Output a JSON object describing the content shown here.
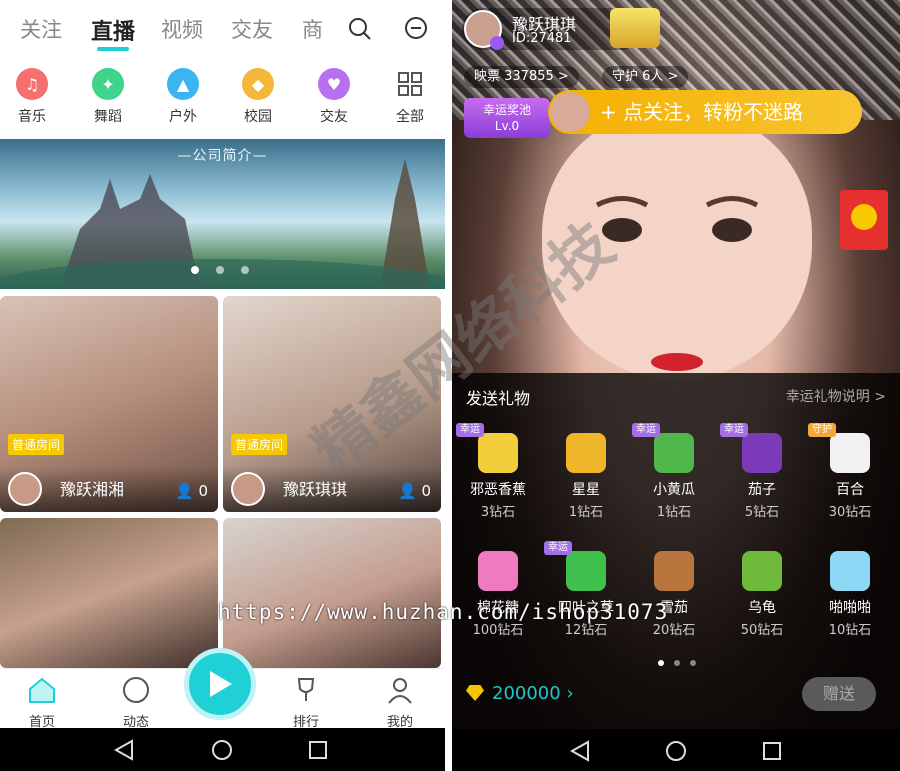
{
  "left": {
    "topnav": {
      "tabs": [
        "关注",
        "直播",
        "视频",
        "交友",
        "商"
      ],
      "active_tab": "直播"
    },
    "categories": [
      {
        "label": "音乐",
        "icon": "music-icon",
        "color": "#f5706f"
      },
      {
        "label": "舞蹈",
        "icon": "dance-icon",
        "color": "#3fd38c"
      },
      {
        "label": "户外",
        "icon": "outdoor-icon",
        "color": "#3bb5f1"
      },
      {
        "label": "校园",
        "icon": "campus-icon",
        "color": "#f5b739"
      },
      {
        "label": "交友",
        "icon": "heart-icon",
        "color": "#b770ef"
      },
      {
        "label": "全部",
        "icon": "grid-icon",
        "color": "#555555"
      }
    ],
    "banner": {
      "title": "—公司简介—"
    },
    "rooms": [
      {
        "tag": "普通房间",
        "name": "豫跃湘湘",
        "count": "0"
      },
      {
        "tag": "普通房间",
        "name": "豫跃琪琪",
        "count": "0"
      },
      {
        "tag": "",
        "name": "",
        "count": ""
      },
      {
        "tag": "",
        "name": "",
        "count": ""
      }
    ],
    "bottomnav": [
      "首页",
      "动态",
      "排行",
      "我的"
    ]
  },
  "right": {
    "host": {
      "name": "豫跃琪琪",
      "id": "ID:27481"
    },
    "stats": {
      "votes": "映票 337855 >",
      "guard": "守护 6人 >"
    },
    "lucky_pool": {
      "line1": "幸运奖池",
      "line2": "Lv.0"
    },
    "follow_banner": "+ 点关注，转粉不迷路",
    "gift_panel": {
      "title": "发送礼物",
      "desc": "幸运礼物说明 >",
      "gifts": [
        {
          "name": "邪恶香蕉",
          "price": "3钻石",
          "badge": "幸运",
          "color": "#f2cf3a"
        },
        {
          "name": "星星",
          "price": "1钻石",
          "badge": "",
          "color": "#f0b62a"
        },
        {
          "name": "小黄瓜",
          "price": "1钻石",
          "badge": "幸运",
          "color": "#4fb64a"
        },
        {
          "name": "茄子",
          "price": "5钻石",
          "badge": "幸运",
          "color": "#7c3ab8"
        },
        {
          "name": "百合",
          "price": "30钻石",
          "badge": "守护",
          "color": "#f1f1f1"
        },
        {
          "name": "棉花糖",
          "price": "100钻石",
          "badge": "",
          "color": "#ef7ac2"
        },
        {
          "name": "四叶之草",
          "price": "12钻石",
          "badge": "幸运",
          "color": "#3fbf4c"
        },
        {
          "name": "雪茄",
          "price": "20钻石",
          "badge": "",
          "color": "#b9753e"
        },
        {
          "name": "乌龟",
          "price": "50钻石",
          "badge": "",
          "color": "#6fba3a"
        },
        {
          "name": "啪啪啪",
          "price": "10钻石",
          "badge": "",
          "color": "#8fd8f5"
        }
      ],
      "balance": "200000",
      "send": "赠送"
    }
  },
  "watermark": "https://www.huzhan.com/ishop31073",
  "watermark2": "精鑫网络科技",
  "colors": {
    "accent": "#1fd1d7",
    "gold": "#f5b000"
  }
}
